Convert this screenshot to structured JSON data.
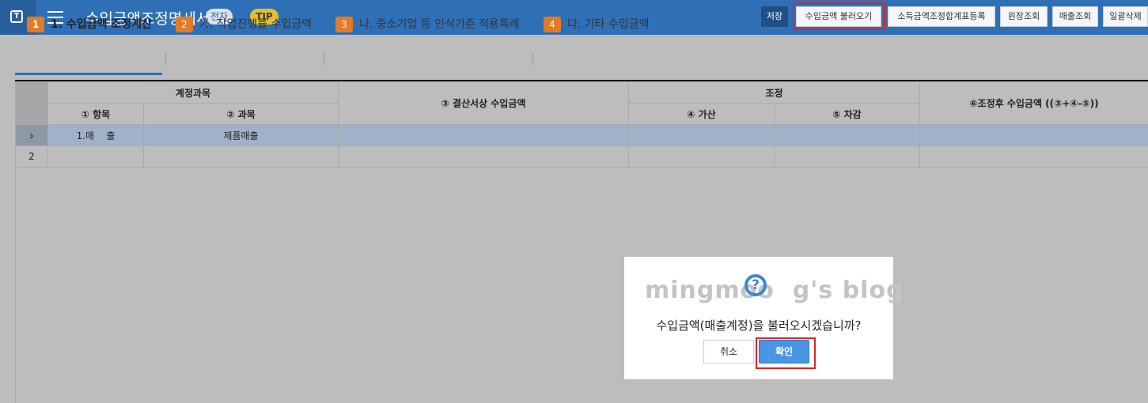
{
  "header": {
    "logo_letter": "T",
    "title": "수입금액조정명세서",
    "badge_digital": "전자",
    "badge_tip": "TIP",
    "buttons": {
      "save": "저장",
      "load_revenue": "수입금액 불러오기",
      "income_adjust_register": "소득금액조정합계표등록",
      "ledger_lookup": "원장조회",
      "sales_lookup": "매출조회",
      "bulk_delete": "일괄삭제"
    }
  },
  "tabs": [
    {
      "num": "1",
      "label": "1. 수입금액 조정계산"
    },
    {
      "num": "2",
      "label": "가. 작업진행률 수입금액"
    },
    {
      "num": "3",
      "label": "나. 중소기업 등 인식기준 적용특례"
    },
    {
      "num": "4",
      "label": "다. 기타 수입금액"
    }
  ],
  "grid": {
    "group_account": "계정과목",
    "col_item": "① 항목",
    "col_subject": "② 과목",
    "col_settlement": "③ 결산서상 수입금액",
    "group_adjust": "조정",
    "col_add": "④ 가산",
    "col_deduct": "⑤ 차감",
    "col_after": "⑥조정후 수입금액 ((③+④-⑤))",
    "rows": [
      {
        "marker": "›",
        "item": "1.매    출",
        "subject": "제품매출"
      },
      {
        "marker": "2",
        "item": "",
        "subject": ""
      }
    ]
  },
  "dialog": {
    "watermark": "mingmoo  g's blog",
    "watermark_glyph": "?",
    "message": "수입금액(매출계정)을 불러오시겠습니까?",
    "cancel": "취소",
    "confirm": "확인"
  },
  "colors": {
    "topbar": "#2f6fb6",
    "tab_number": "#e27a28",
    "highlight_box": "#e02323",
    "confirm_button": "#4a96e3"
  }
}
